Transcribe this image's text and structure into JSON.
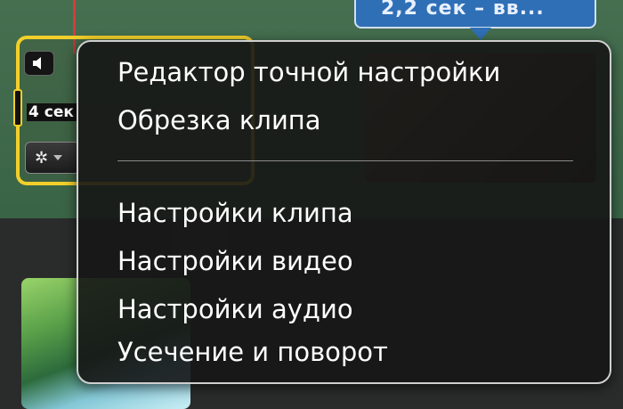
{
  "bubble": {
    "text": "2,2 сек – вв..."
  },
  "clip": {
    "duration": "4 сек"
  },
  "menu": {
    "items_top": [
      {
        "label": "Редактор точной настройки"
      },
      {
        "label": "Обрезка клипа"
      }
    ],
    "items_bottom": [
      {
        "label": "Настройки клипа"
      },
      {
        "label": "Настройки видео"
      },
      {
        "label": "Настройки аудио"
      },
      {
        "label": "Усечение и поворот"
      }
    ]
  },
  "colors": {
    "selection": "#f2cf2a",
    "playhead": "#d83a3a",
    "bubble": "#2f6fb6"
  }
}
